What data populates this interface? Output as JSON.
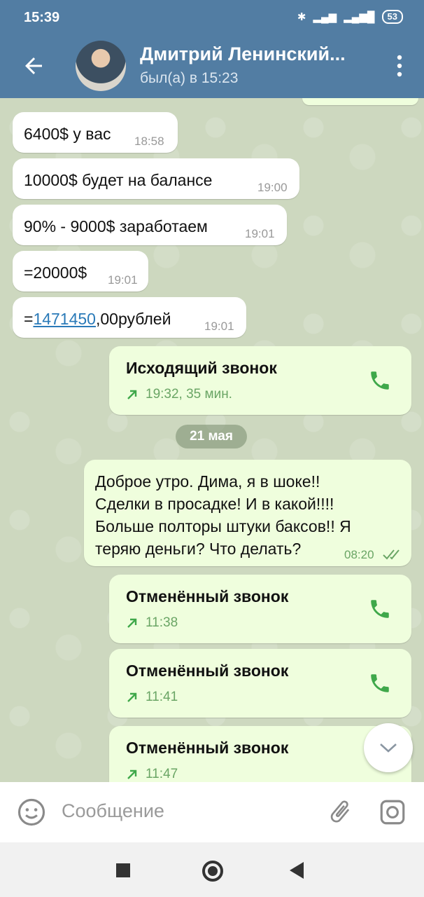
{
  "statusbar": {
    "time": "15:39",
    "battery": "53",
    "signal": "R   4G"
  },
  "header": {
    "title": "Дмитрий Ленинский...",
    "subtitle": "был(а) в 15:23"
  },
  "messages": [
    {
      "text": "6400$ у вас",
      "time": "18:58"
    },
    {
      "text": "10000$  будет на балансе",
      "time": "19:00"
    },
    {
      "text": "90% - 9000$ заработаем",
      "time": "19:01"
    },
    {
      "text": "=20000$",
      "time": "19:01"
    },
    {
      "prefix": "=",
      "link": "1471450",
      "suffix": ",00рублей",
      "time": "19:01"
    }
  ],
  "call_out": {
    "title": "Исходящий звонок",
    "meta": "19:32, 35 мин."
  },
  "date_divider": "21 мая",
  "out_message": {
    "lines": [
      "Доброе утро. Дима, я в шоке!!",
      "Сделки в просадке! И в какой!!!!",
      "Больше полторы штуки баксов!! Я",
      "теряю деньги? Что делать?"
    ],
    "time": "08:20"
  },
  "cancelled_calls": [
    {
      "title": "Отменённый звонок",
      "time": "11:38"
    },
    {
      "title": "Отменённый звонок",
      "time": "11:41"
    },
    {
      "title": "Отменённый звонок",
      "time": "11:47"
    }
  ],
  "input": {
    "placeholder": "Сообщение"
  },
  "colors": {
    "header": "#527da3",
    "out_bubble": "#effedd",
    "call_green": "#3fa84a"
  }
}
